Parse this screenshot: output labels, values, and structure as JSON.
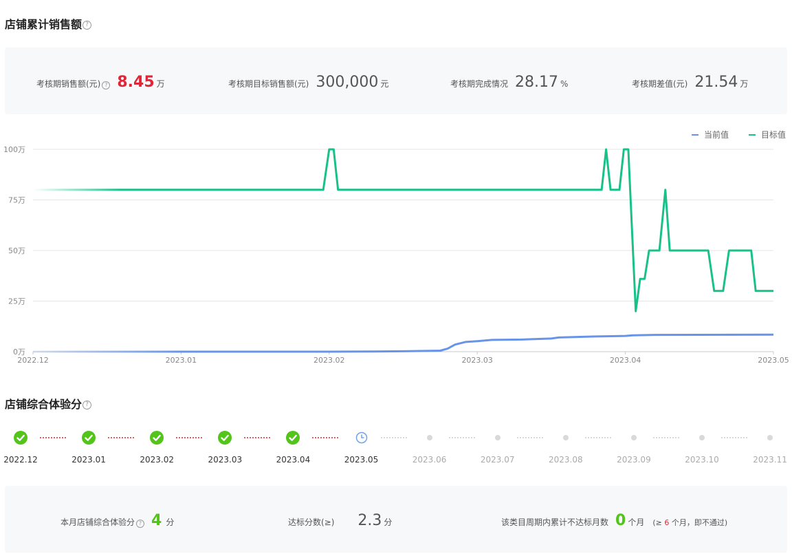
{
  "sales_section": {
    "title": "店铺累计销售额",
    "stats": {
      "sales": {
        "label": "考核期销售额(元)",
        "value": "8.45",
        "unit": "万"
      },
      "target": {
        "label": "考核期目标销售额(元)",
        "value": "300,000",
        "unit": "元"
      },
      "completion": {
        "label": "考核期完成情况",
        "value": "28.17",
        "unit": "%"
      },
      "gap": {
        "label": "考核期差值(元)",
        "value": "21.54",
        "unit": "万"
      }
    }
  },
  "chart_data": {
    "type": "line",
    "x_ticks": [
      "2022.12",
      "2023.01",
      "2023.02",
      "2023.03",
      "2023.04",
      "2023.05"
    ],
    "y_ticks": [
      "0万",
      "25万",
      "50万",
      "75万",
      "100万"
    ],
    "ylim": [
      0,
      100
    ],
    "grid": true,
    "legend_position": "top-right",
    "series": [
      {
        "name": "当前值",
        "color": "#6794e8",
        "points": [
          [
            0,
            0
          ],
          [
            2,
            0
          ],
          [
            2.3,
            0.1
          ],
          [
            2.5,
            0.2
          ],
          [
            2.75,
            0.5
          ],
          [
            2.8,
            1.5
          ],
          [
            2.85,
            3.5
          ],
          [
            2.92,
            4.8
          ],
          [
            3,
            5.2
          ],
          [
            3.1,
            5.8
          ],
          [
            3.3,
            6
          ],
          [
            3.5,
            6.5
          ],
          [
            3.55,
            7
          ],
          [
            3.8,
            7.5
          ],
          [
            4,
            7.8
          ],
          [
            4.05,
            8.1
          ],
          [
            4.2,
            8.3
          ],
          [
            5,
            8.45
          ]
        ]
      },
      {
        "name": "目标值",
        "color": "#19c088",
        "points": [
          [
            0,
            80
          ],
          [
            1.96,
            80
          ],
          [
            2,
            100
          ],
          [
            2.03,
            100
          ],
          [
            2.06,
            80
          ],
          [
            3.84,
            80
          ],
          [
            3.87,
            100
          ],
          [
            3.9,
            80
          ],
          [
            3.96,
            80
          ],
          [
            3.99,
            100
          ],
          [
            4.02,
            100
          ],
          [
            4.07,
            20
          ],
          [
            4.1,
            36
          ],
          [
            4.13,
            36
          ],
          [
            4.16,
            50
          ],
          [
            4.23,
            50
          ],
          [
            4.27,
            80
          ],
          [
            4.3,
            50
          ],
          [
            4.56,
            50
          ],
          [
            4.6,
            30
          ],
          [
            4.66,
            30
          ],
          [
            4.7,
            50
          ],
          [
            4.85,
            50
          ],
          [
            4.88,
            30
          ],
          [
            5,
            30
          ]
        ]
      }
    ]
  },
  "experience_section": {
    "title": "店铺综合体验分",
    "timeline": [
      {
        "label": "2022.12",
        "status": "done"
      },
      {
        "label": "2023.01",
        "status": "done"
      },
      {
        "label": "2023.02",
        "status": "done"
      },
      {
        "label": "2023.03",
        "status": "done"
      },
      {
        "label": "2023.04",
        "status": "done"
      },
      {
        "label": "2023.05",
        "status": "current"
      },
      {
        "label": "2023.06",
        "status": "future"
      },
      {
        "label": "2023.07",
        "status": "future"
      },
      {
        "label": "2023.08",
        "status": "future"
      },
      {
        "label": "2023.09",
        "status": "future"
      },
      {
        "label": "2023.10",
        "status": "future"
      },
      {
        "label": "2023.11",
        "status": "future"
      }
    ],
    "stats": {
      "score": {
        "label": "本月店铺综合体验分",
        "value": "4",
        "unit": "分"
      },
      "standard": {
        "label": "达标分数(≥)",
        "value": "2.3",
        "unit": "分"
      },
      "fail": {
        "label": "该类目周期内累计不达标月数",
        "value": "0",
        "unit": "个月",
        "note_prefix": "(≥",
        "note_num": "6",
        "note_suffix": "个月，即不通过)"
      }
    }
  }
}
